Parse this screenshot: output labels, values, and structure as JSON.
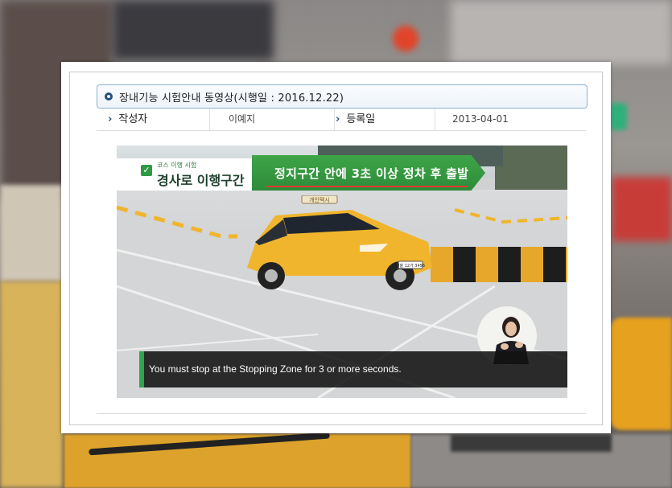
{
  "post": {
    "title": "장내기능 시험안내 동영상(시행일 : 2016.12.22)",
    "author_label": "작성자",
    "author_value": "이예지",
    "date_label": "등록일",
    "date_value": "2013-04-01"
  },
  "video": {
    "caption_small": "코스 이행 시험",
    "caption_main": "경사로 이행구간",
    "caption_green": "정지구간 안에 3초 이상 정차 후 출발",
    "subtitle": "You must stop at the Stopping Zone for 3 or more seconds.",
    "taxi_sign": "개인택시",
    "plate": "서울 12가 3456"
  },
  "colors": {
    "accent_blue": "#23507f",
    "caption_green": "#3ea547",
    "taxi_yellow": "#f0b52c"
  }
}
